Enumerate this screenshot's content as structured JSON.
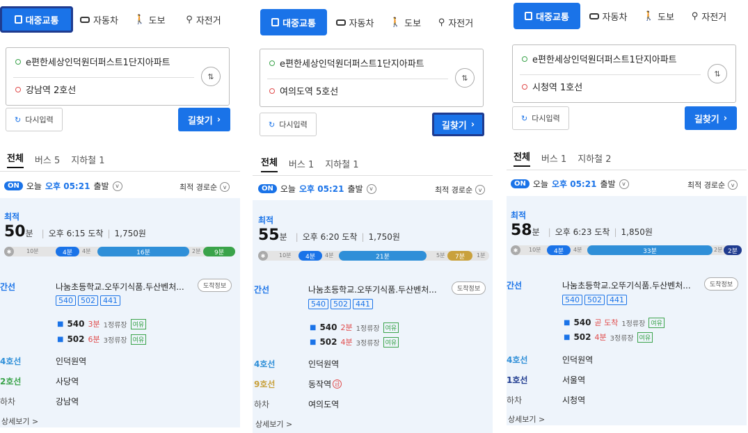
{
  "panels": [
    {
      "modes": {
        "transit": "대중교통",
        "car": "자동차",
        "walk": "도보",
        "bike": "자전거"
      },
      "origin": "e편한세상인덕원더퍼스트1단지아파트",
      "destination": "강남역 2호선",
      "reset_label": "다시입력",
      "go_label": "길찾기",
      "tabs": {
        "all": "전체",
        "bus": "버스 5",
        "subway": "지하철 1"
      },
      "on_label": "ON",
      "depart_prefix": "오늘",
      "depart_time": "오후 05:21",
      "depart_suffix": "출발",
      "sort_label": "최적 경로순",
      "best_label": "최적",
      "duration_num": "50",
      "duration_unit": "분",
      "arrive": "오후 6:15 도착",
      "fare": "1,750원",
      "bar": {
        "walk1": "10분",
        "bus": "4분",
        "wait1": "4분",
        "sub1": "16분",
        "wait2": "2분",
        "sub2": "9분"
      },
      "leg1_label": "간선",
      "leg1_place": "나눔초등학교.오뚜기식품.두산벤처...",
      "arrival_info": "도착정보",
      "routes": [
        "540",
        "502",
        "441"
      ],
      "bus_a": {
        "num": "540",
        "time": "3분",
        "stop": "1정류장",
        "status": "여유"
      },
      "bus_b": {
        "num": "502",
        "time": "6분",
        "stop": "3정류장",
        "status": "여유"
      },
      "leg2_label": "4호선",
      "leg2_place": "인덕원역",
      "leg3_label": "2호선",
      "leg3_place": "사당역",
      "leg4_label": "하차",
      "leg4_place": "강남역",
      "more": "상세보기 >"
    },
    {
      "modes": {
        "transit": "대중교통",
        "car": "자동차",
        "walk": "도보",
        "bike": "자전거"
      },
      "origin": "e편한세상인덕원더퍼스트1단지아파트",
      "destination": "여의도역 5호선",
      "reset_label": "다시입력",
      "go_label": "길찾기",
      "tabs": {
        "all": "전체",
        "bus": "버스 1",
        "subway": "지하철 1"
      },
      "on_label": "ON",
      "depart_prefix": "오늘",
      "depart_time": "오후 05:21",
      "depart_suffix": "출발",
      "sort_label": "최적 경로순",
      "best_label": "최적",
      "duration_num": "55",
      "duration_unit": "분",
      "arrive": "오후 6:20 도착",
      "fare": "1,750원",
      "bar": {
        "walk1": "10분",
        "bus": "4분",
        "wait1": "4분",
        "sub1": "21분",
        "wait2": "5분",
        "sub2": "7분",
        "end": "1분"
      },
      "leg1_label": "간선",
      "leg1_place": "나눔초등학교.오뚜기식품.두산벤처...",
      "arrival_info": "도착정보",
      "routes": [
        "540",
        "502",
        "441"
      ],
      "bus_a": {
        "num": "540",
        "time": "2분",
        "stop": "1정류장",
        "status": "여유"
      },
      "bus_b": {
        "num": "502",
        "time": "4분",
        "stop": "3정류장",
        "status": "여유"
      },
      "leg2_label": "4호선",
      "leg2_place": "인덕원역",
      "leg3_label": "9호선",
      "leg3_place": "동작역",
      "leg3_badge": "급",
      "leg4_label": "하차",
      "leg4_place": "여의도역",
      "more": "상세보기 >"
    },
    {
      "modes": {
        "transit": "대중교통",
        "car": "자동차",
        "walk": "도보",
        "bike": "자전거"
      },
      "origin": "e편한세상인덕원더퍼스트1단지아파트",
      "destination": "시청역 1호선",
      "reset_label": "다시입력",
      "go_label": "길찾기",
      "tabs": {
        "all": "전체",
        "bus": "버스 1",
        "subway": "지하철 2"
      },
      "on_label": "ON",
      "depart_prefix": "오늘",
      "depart_time": "오후 05:21",
      "depart_suffix": "출발",
      "sort_label": "최적 경로순",
      "best_label": "최적",
      "duration_num": "58",
      "duration_unit": "분",
      "arrive": "오후 6:23 도착",
      "fare": "1,850원",
      "bar": {
        "walk1": "10분",
        "bus": "4분",
        "wait1": "4분",
        "sub1": "33분",
        "wait2": "2분",
        "sub2": "2분"
      },
      "leg1_label": "간선",
      "leg1_place": "나눔초등학교.오뚜기식품.두산벤처...",
      "arrival_info": "도착정보",
      "routes": [
        "540",
        "502",
        "441"
      ],
      "bus_a": {
        "num": "540",
        "time": "곧 도착",
        "stop": "1정류장",
        "status": "여유"
      },
      "bus_b": {
        "num": "502",
        "time": "4분",
        "stop": "3정류장",
        "status": "여유"
      },
      "leg2_label": "4호선",
      "leg2_place": "인덕원역",
      "leg3_label": "1호선",
      "leg3_place": "서울역",
      "leg4_label": "하차",
      "leg4_place": "시청역",
      "more": "상세보기 >"
    }
  ],
  "colors": {
    "accent": "#1a73e8",
    "line4": "#2f8fd8",
    "line2": "#3aa34a",
    "line9": "#c9a13c",
    "line1": "#1f3b8f"
  }
}
